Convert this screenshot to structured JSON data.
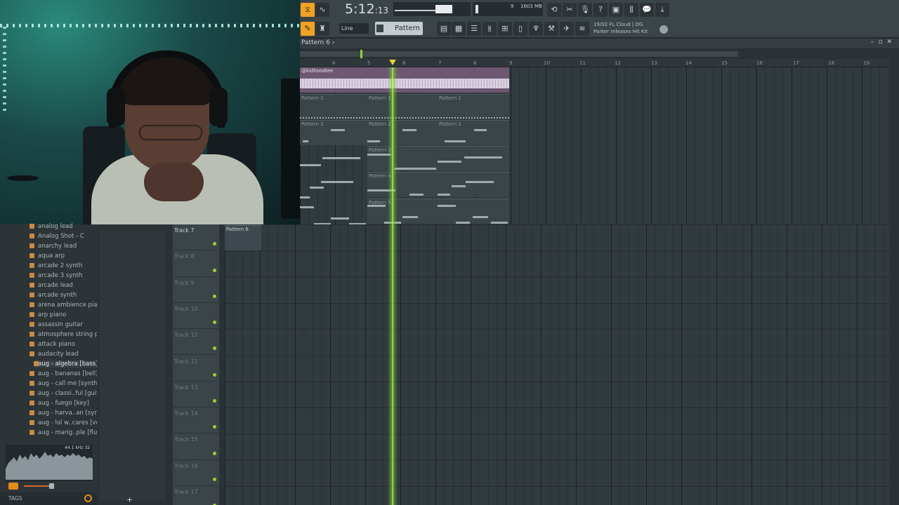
{
  "toolbar": {
    "clock_main": "5:12",
    "clock_sub": ":13",
    "cpu_value": "1603 MB",
    "cpu_poly": "9",
    "snap_mode": "Line",
    "pattern": "Pattern 6",
    "news_date": "19/02",
    "news_title": "FL Cloud | OG",
    "news_text": "Parker releases Hit Kit"
  },
  "playlist": {
    "title": "Pattern 6",
    "title_arrow": "›",
    "ruler_ticks": [
      "4",
      "5",
      "6",
      "7",
      "8",
      "9",
      "10",
      "11",
      "12",
      "13",
      "14",
      "15",
      "16",
      "17",
      "18",
      "19"
    ]
  },
  "audio_clip": {
    "label": "@kidhoodiee"
  },
  "pattern_labels": {
    "p1": "Pattern 1",
    "p2": "Pattern 2",
    "p3": "Pattern 3",
    "p4": "Pattern 4",
    "p5": "Pattern 5",
    "p6": "Pattern 6"
  },
  "browser": {
    "items": [
      "analog lead",
      "Analog Shot - C",
      "anarchy lead",
      "aqua arp",
      "arcade 2 synth",
      "arcade 3 synth",
      "arcade lead",
      "arcade synth",
      "arena ambience piano",
      "arp piano",
      "assassin guitar",
      "atmosphere string pad",
      "attack piano",
      "audacity lead",
      "aug - algebra [bass]",
      "aug - bananas [bell]",
      "aug - call me [synth]",
      "aug - classi..ful [guitar]",
      "aug - fuego [key]",
      "aug - harva..an [synth]",
      "aug - lol w..cares [vox]",
      "aug - marig..ple [flute]"
    ],
    "selected_index": 14,
    "preview_info": "44.1 kHz 32",
    "tags_label": "TAGS"
  },
  "mid_panel": {
    "add_label": "+"
  },
  "tracks": [
    "Track 7",
    "Track 8",
    "Track 9",
    "Track 10",
    "Track 11",
    "Track 12",
    "Track 13",
    "Track 14",
    "Track 15",
    "Track 16",
    "Track 17"
  ],
  "colors": {
    "accent": "#f0a225",
    "playhead": "#9bd12a",
    "audio_clip": "#6d5872"
  }
}
